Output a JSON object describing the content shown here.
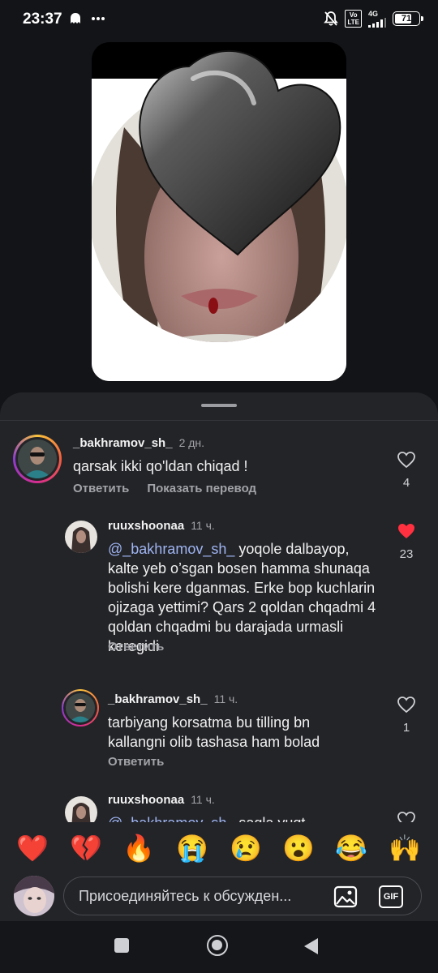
{
  "status_bar": {
    "time": "23:37",
    "volte": "Vo\nLTE",
    "network": "4G",
    "battery": "71",
    "battery_level": 0.71
  },
  "comments": [
    {
      "username": "_bakhramov_sh_",
      "time": "2 дн.",
      "text": "qarsak ikki qo'ldan chiqad !",
      "reply_label": "Ответить",
      "translate_label": "Показать перевод",
      "likes": "4",
      "liked": false
    },
    {
      "username": "ruuxshoonaa",
      "time": "11 ч.",
      "mention": "@_bakhramov_sh_",
      "text": "yoqole dalbayop, kalte yeb o’sgan bosen hamma shunaqa bolishi kere dganmas. Erke bop kuchlarin ojizaga yettimi? Qars 2 qoldan chqadmi 4 qoldan chqadmi bu darajada urmasli keregidi",
      "reply_label": "Ответить",
      "likes": "23",
      "liked": true
    },
    {
      "username": "_bakhramov_sh_",
      "time": "11 ч.",
      "text": "tarbiyang korsatma bu tilling bn kallangni olib tashasa ham bolad",
      "reply_label": "Ответить",
      "likes": "1",
      "liked": false
    },
    {
      "username": "ruuxshoonaa",
      "time": "11 ч.",
      "mention": "@_bakhramov_sh_",
      "text": "sagla yuqt"
    }
  ],
  "emoji_bar": [
    "❤️",
    "💔",
    "🔥",
    "😭",
    "😢",
    "😮",
    "😂",
    "🙌"
  ],
  "composer": {
    "placeholder": "Присоединяйтесь к обсужден...",
    "gif_label": "GIF"
  },
  "colors": {
    "sheet_bg": "#232428",
    "accent_like": "#ff3040",
    "mention": "#9fb4f2"
  }
}
